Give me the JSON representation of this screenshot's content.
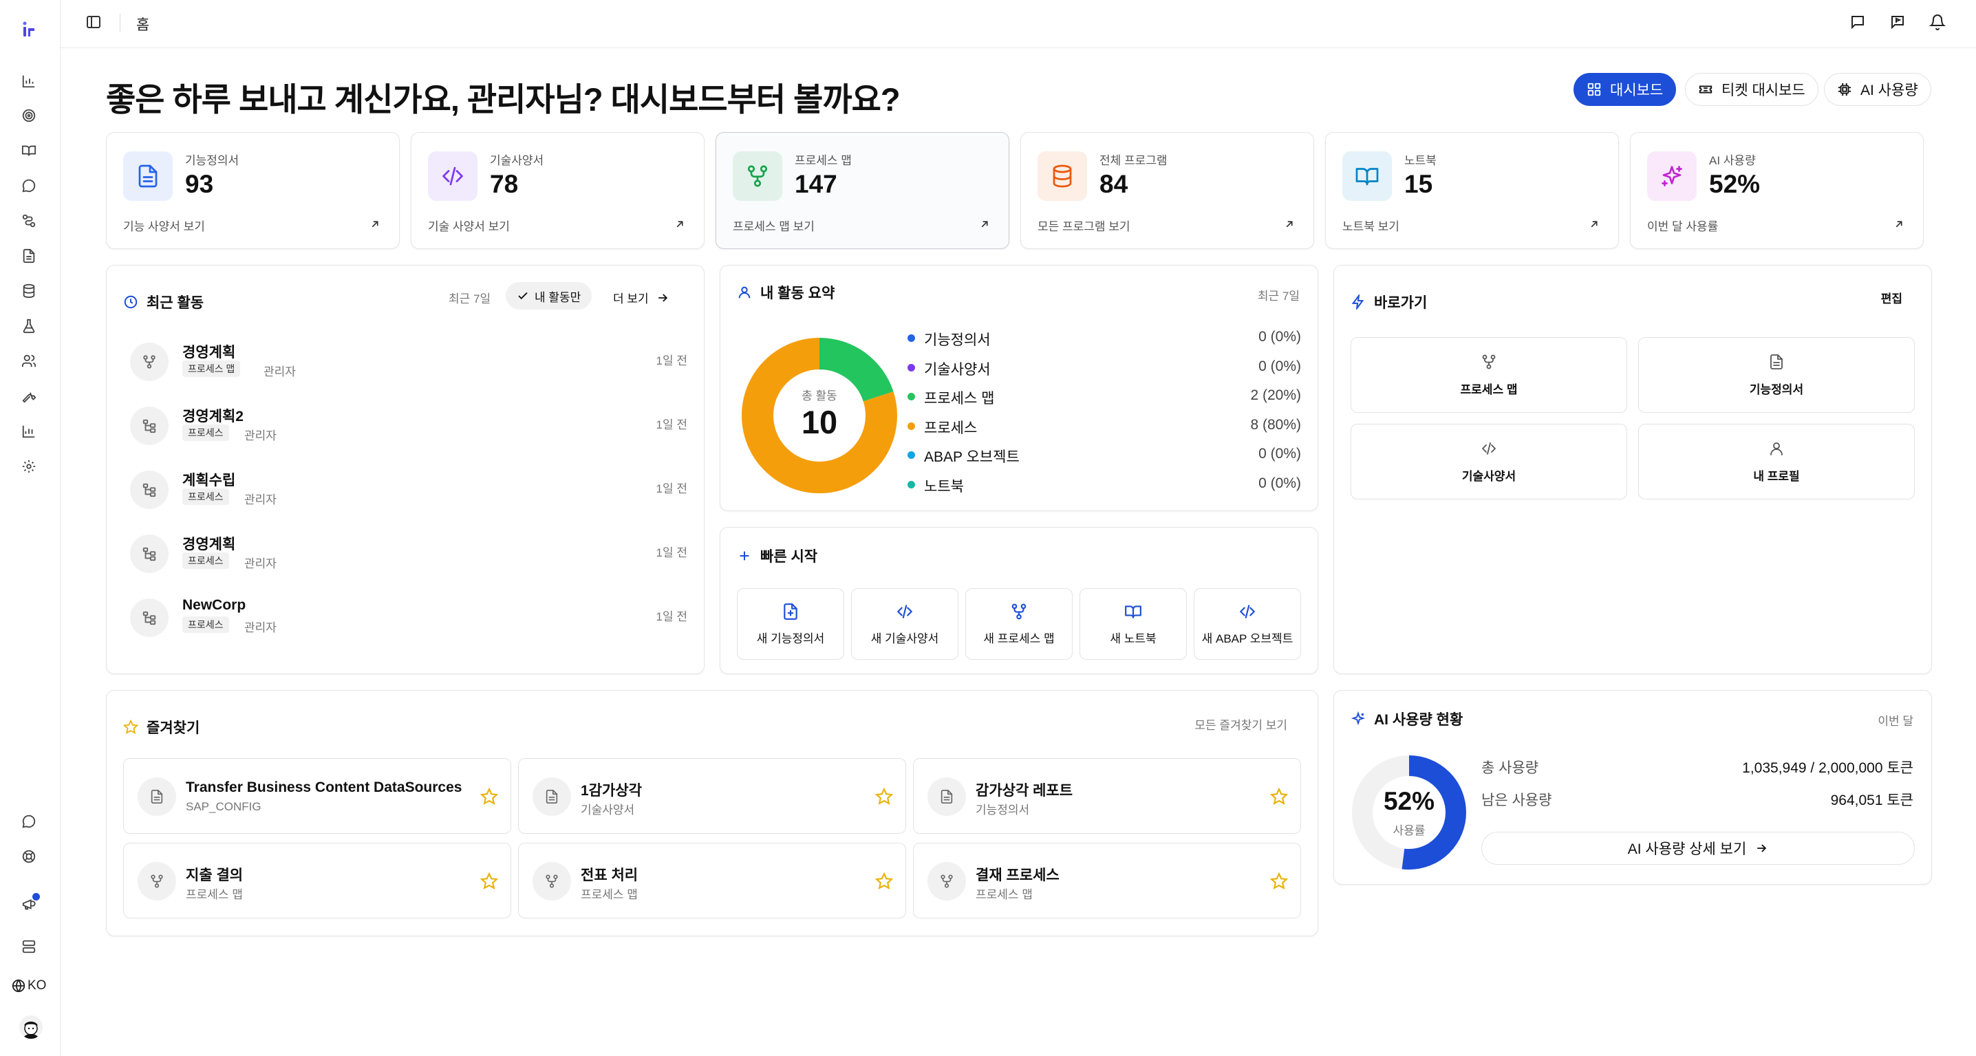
{
  "topbar": {
    "breadcrumb": "홈"
  },
  "header": {
    "greeting": "좋은 하루 보내고 계신가요, 관리자님? 대시보드부터 볼까요?",
    "buttons": {
      "dashboard": "대시보드",
      "ticket_dashboard": "티켓 대시보드",
      "ai_usage": "AI 사용량"
    }
  },
  "stats": [
    {
      "label": "기능정의서",
      "value": "93",
      "link": "기능 사양서 보기",
      "icon": "document-icon",
      "color": "#2563eb"
    },
    {
      "label": "기술사양서",
      "value": "78",
      "link": "기술 사양서 보기",
      "icon": "code-icon",
      "color": "#7c3aed"
    },
    {
      "label": "프로세스 맵",
      "value": "147",
      "link": "프로세스 맵 보기",
      "icon": "process-map-icon",
      "color": "#16a34a"
    },
    {
      "label": "전체 프로그램",
      "value": "84",
      "link": "모든 프로그램 보기",
      "icon": "database-icon",
      "color": "#ea580c"
    },
    {
      "label": "노트북",
      "value": "15",
      "link": "노트북 보기",
      "icon": "book-icon",
      "color": "#0284c7"
    },
    {
      "label": "AI 사용량",
      "value": "52%",
      "link": "이번 달 사용률",
      "icon": "sparkles-icon",
      "color": "#c026d3"
    }
  ],
  "recent": {
    "title": "최근 활동",
    "period": "최근 7일",
    "filter": "내 활동만",
    "more": "더 보기",
    "items": [
      {
        "name": "경영계획",
        "type": "프로세스 맵",
        "owner": "관리자",
        "time": "1일 전",
        "icon": "process-map-icon"
      },
      {
        "name": "경영계획2",
        "type": "프로세스",
        "owner": "관리자",
        "time": "1일 전",
        "icon": "process-tree-icon"
      },
      {
        "name": "계획수립",
        "type": "프로세스",
        "owner": "관리자",
        "time": "1일 전",
        "icon": "process-tree-icon"
      },
      {
        "name": "경영계획",
        "type": "프로세스",
        "owner": "관리자",
        "time": "1일 전",
        "icon": "process-tree-icon"
      },
      {
        "name": "NewCorp",
        "type": "프로세스",
        "owner": "관리자",
        "time": "1일 전",
        "icon": "process-tree-icon"
      }
    ]
  },
  "summary": {
    "title": "내 활동 요약",
    "period": "최근 7일",
    "center_label": "총 활동",
    "center_value": "10",
    "legend": [
      {
        "name": "기능정의서",
        "value": "0 (0%)",
        "count": 0,
        "color": "#2563eb"
      },
      {
        "name": "기술사양서",
        "value": "0 (0%)",
        "count": 0,
        "color": "#7c3aed"
      },
      {
        "name": "프로세스 맵",
        "value": "2 (20%)",
        "count": 2,
        "color": "#22c55e"
      },
      {
        "name": "프로세스",
        "value": "8 (80%)",
        "count": 8,
        "color": "#f59e0b"
      },
      {
        "name": "ABAP 오브젝트",
        "value": "0 (0%)",
        "count": 0,
        "color": "#0ea5e9"
      },
      {
        "name": "노트북",
        "value": "0 (0%)",
        "count": 0,
        "color": "#14b8a6"
      }
    ]
  },
  "quick_start": {
    "title": "빠른 시작",
    "items": [
      {
        "label": "새 기능정의서",
        "icon": "new-document-icon"
      },
      {
        "label": "새 기술사양서",
        "icon": "code-icon"
      },
      {
        "label": "새 프로세스 맵",
        "icon": "process-map-icon"
      },
      {
        "label": "새 노트북",
        "icon": "book-icon"
      },
      {
        "label": "새 ABAP 오브젝트",
        "icon": "code-icon"
      }
    ]
  },
  "shortcuts": {
    "title": "바로가기",
    "edit": "편집",
    "items": [
      {
        "label": "프로세스 맵",
        "icon": "process-map-icon"
      },
      {
        "label": "기능정의서",
        "icon": "document-icon"
      },
      {
        "label": "기술사양서",
        "icon": "code-icon"
      },
      {
        "label": "내 프로필",
        "icon": "user-icon"
      }
    ]
  },
  "favorites": {
    "title": "즐겨찾기",
    "view_all": "모든 즐겨찾기 보기",
    "items": [
      {
        "name": "Transfer Business Content DataSources",
        "sub": "SAP_CONFIG",
        "icon": "document-icon"
      },
      {
        "name": "1감가상각",
        "sub": "기술사양서",
        "icon": "document-icon"
      },
      {
        "name": "감가상각 레포트",
        "sub": "기능정의서",
        "icon": "document-icon"
      },
      {
        "name": "지출 결의",
        "sub": "프로세스 맵",
        "icon": "process-map-icon"
      },
      {
        "name": "전표 처리",
        "sub": "프로세스 맵",
        "icon": "process-map-icon"
      },
      {
        "name": "결재 프로세스",
        "sub": "프로세스 맵",
        "icon": "process-map-icon"
      }
    ]
  },
  "ai_usage": {
    "title": "AI 사용량 현황",
    "period": "이번 달",
    "percent_text": "52%",
    "percent_label": "사용률",
    "percent": 0.52,
    "total_label": "총 사용량",
    "total_value": "1,035,949 / 2,000,000 토큰",
    "remaining_label": "남은 사용량",
    "remaining_value": "964,051 토큰",
    "detail_button": "AI 사용량 상세 보기"
  },
  "sidebar": {
    "language": "KO"
  },
  "colors": {
    "accent": "#1d4ed8",
    "notification_dot": "#1d4ed8",
    "star": "#eab308"
  }
}
